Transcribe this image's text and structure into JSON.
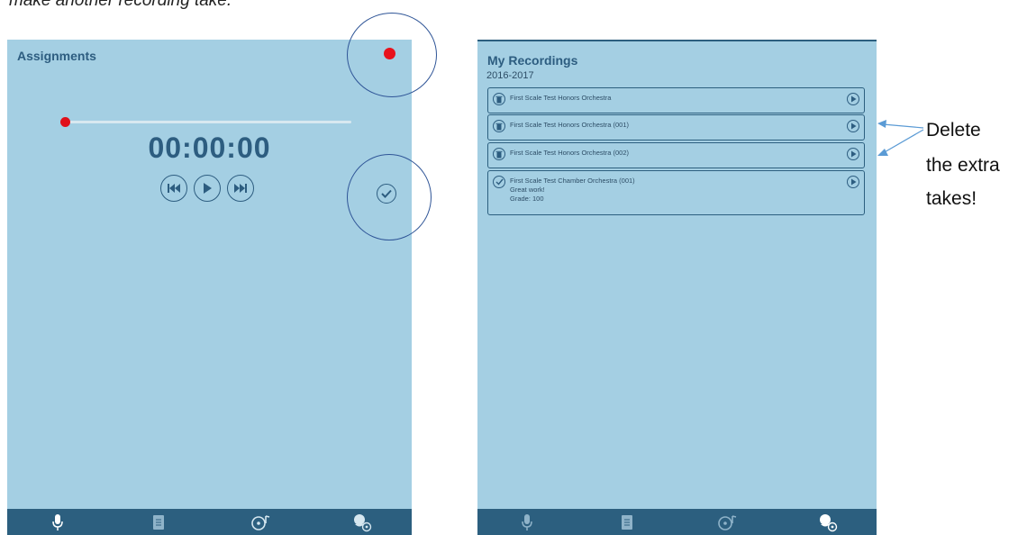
{
  "caption": "make another recording take.",
  "left_screen": {
    "title": "Assignments",
    "timer": "00:00:00",
    "record_indicator_color": "#e8121c",
    "playback_position": 0,
    "controls": [
      "rewind-icon",
      "play-icon",
      "fast-forward-icon"
    ],
    "submit_icon": "checkmark-icon"
  },
  "right_screen": {
    "title": "My Recordings",
    "year": "2016-2017",
    "recordings": [
      {
        "title": "First Scale Test Honors Orchestra",
        "icon": "trash-icon"
      },
      {
        "title": "First Scale Test Honors Orchestra (001)",
        "icon": "trash-icon"
      },
      {
        "title": "First Scale Test Honors Orchestra (002)",
        "icon": "trash-icon"
      },
      {
        "title": "First Scale Test Chamber Orchestra (001)",
        "icon": "checkmark-icon",
        "comment": "Great work!",
        "grade": "Grade: 100"
      }
    ]
  },
  "tab_bar": {
    "tabs": [
      "microphone-icon",
      "document-icon",
      "music-disc-icon",
      "user-settings-icon"
    ],
    "left_active": 0,
    "right_active": 3
  },
  "annotation": {
    "lines": [
      "Delete",
      "the extra",
      "takes!"
    ]
  },
  "colors": {
    "screen_bg": "#a4cfe3",
    "bar": "#2c5f7f",
    "text": "#2d5d80",
    "annotation": "#2f5597"
  }
}
